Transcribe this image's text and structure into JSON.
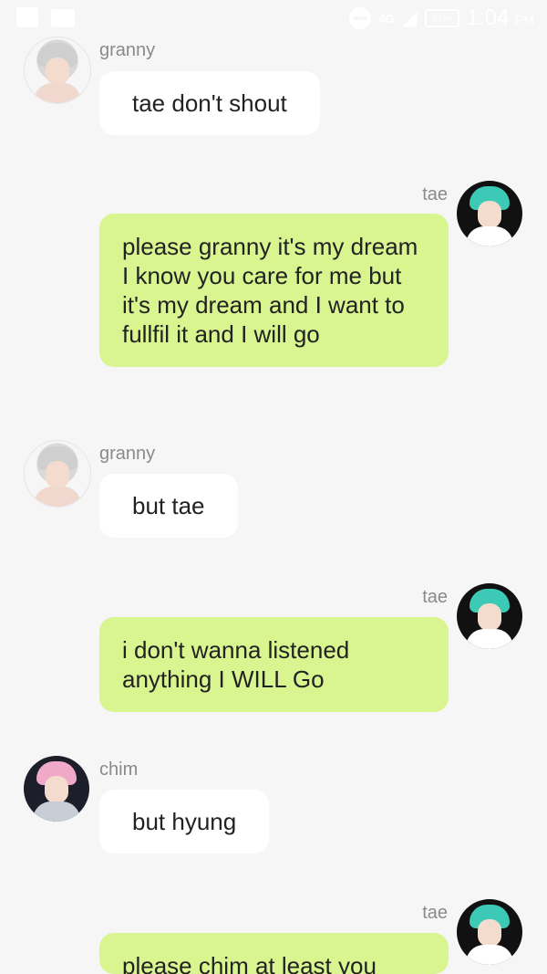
{
  "status_bar": {
    "left_icons": [
      "image-icon",
      "folder-icon"
    ],
    "right_icons": [
      "dnd-icon",
      "signal-icon",
      "battery-icon"
    ],
    "network": "4G",
    "battery": "31%",
    "time": "1:04",
    "ampm": "PM"
  },
  "messages": [
    {
      "sender": "granny",
      "side": "left",
      "text": "tae don't shout"
    },
    {
      "sender": "tae",
      "side": "right",
      "text": "please granny it's my dream I know you care for me but it's my dream and I want to fullfil it and I will go"
    },
    {
      "sender": "granny",
      "side": "left",
      "text": "but tae"
    },
    {
      "sender": "tae",
      "side": "right",
      "text": "i don't wanna listened anything I WILL Go"
    },
    {
      "sender": "chim",
      "side": "left",
      "text": "but hyung"
    },
    {
      "sender": "tae",
      "side": "right",
      "text": "please chim at least you"
    }
  ],
  "colors": {
    "background": "#f6f6f6",
    "bubble_incoming": "#ffffff",
    "bubble_outgoing": "#d8f58f",
    "name_text": "#8a8a8a"
  }
}
